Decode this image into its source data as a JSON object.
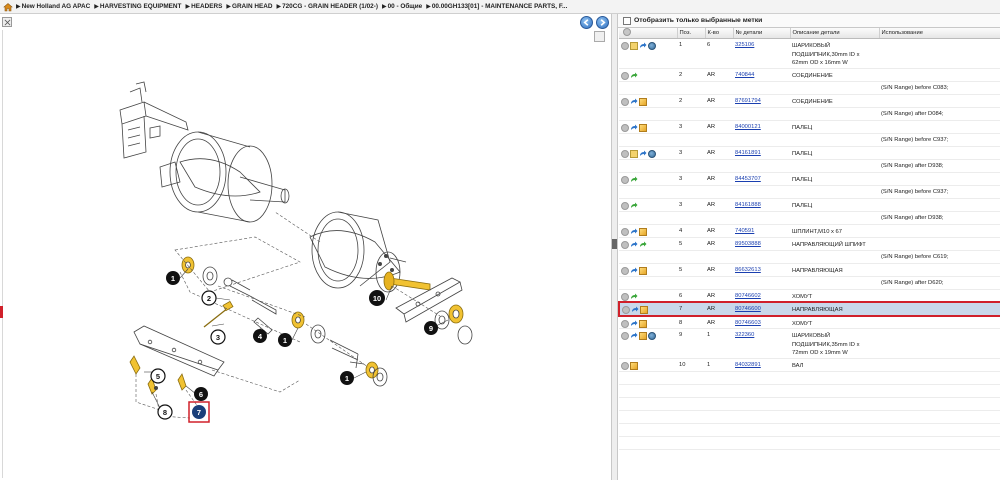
{
  "breadcrumb": {
    "home_icon": "home-icon",
    "items": [
      "New Holland AG APAC",
      "HARVESTING EQUIPMENT",
      "HEADERS",
      "GRAIN HEAD",
      "720CG - GRAIN HEADER (1/02-)",
      "00 - Общие",
      "00.00GH133[01] - MAINTENANCE PARTS, F..."
    ]
  },
  "toolbar": {
    "expand_icon": "expand-icon",
    "prev_icon": "prev-page-icon",
    "next_icon": "next-page-icon"
  },
  "diagram": {
    "callouts": [
      "1",
      "1",
      "1",
      "2",
      "3",
      "4",
      "5",
      "6",
      "7",
      "8",
      "9",
      "10"
    ],
    "highlighted_callout": "7"
  },
  "filter": {
    "label": "Отобразить только выбранные метки",
    "checked": false
  },
  "table": {
    "columns": [
      "",
      "Поз.",
      "К-во",
      "№ детали",
      "Описание детали",
      "Использование"
    ],
    "rows": [
      {
        "icons": [
          "circle",
          "note",
          "arrow-blue",
          "globe"
        ],
        "pos": "1",
        "qty": "6",
        "part": "325106",
        "desc": "ШАРИКОВЫЙ ПОДШИПНИК,30mm ID x 62mm OD x 16mm W",
        "usage": "",
        "selected": false
      },
      {
        "icons": [
          "circle",
          "arrow-green"
        ],
        "pos": "2",
        "qty": "AR",
        "part": "740844",
        "desc": "СОЕДИНЕНИЕ",
        "usage": "",
        "note": "(S/N Range) before C083;",
        "selected": false
      },
      {
        "icons": [
          "circle",
          "arrow-blue",
          "box"
        ],
        "pos": "2",
        "qty": "AR",
        "part": "87691794",
        "desc": "СОЕДИНЕНИЕ",
        "usage": "",
        "note": "(S/N Range) after D084;",
        "selected": false
      },
      {
        "icons": [
          "circle",
          "arrow-blue",
          "box"
        ],
        "pos": "3",
        "qty": "AR",
        "part": "84000121",
        "desc": "ПАЛЕЦ",
        "usage": "",
        "note": "(S/N Range) before C937;",
        "selected": false
      },
      {
        "icons": [
          "circle",
          "note",
          "arrow-blue",
          "globe"
        ],
        "pos": "3",
        "qty": "AR",
        "part": "84161891",
        "desc": "ПАЛЕЦ",
        "usage": "",
        "note": "(S/N Range) after D938;",
        "selected": false
      },
      {
        "icons": [
          "circle",
          "arrow-green"
        ],
        "pos": "3",
        "qty": "AR",
        "part": "84453707",
        "desc": "ПАЛЕЦ",
        "usage": "",
        "note": "(S/N Range) before C937;",
        "selected": false
      },
      {
        "icons": [
          "circle",
          "arrow-green"
        ],
        "pos": "3",
        "qty": "AR",
        "part": "84161888",
        "desc": "ПАЛЕЦ",
        "usage": "",
        "note": "(S/N Range) after D938;",
        "selected": false
      },
      {
        "icons": [
          "circle",
          "arrow-blue",
          "box"
        ],
        "pos": "4",
        "qty": "AR",
        "part": "740591",
        "desc": "ШПЛИНТ,M10 x 67",
        "usage": "",
        "selected": false
      },
      {
        "icons": [
          "circle",
          "arrow-blue",
          "arrow-green"
        ],
        "pos": "5",
        "qty": "AR",
        "part": "89503888",
        "desc": "НАПРАВЛЯЮЩИЙ ШПИФТ",
        "usage": "",
        "note": "(S/N Range) before C619;",
        "selected": false
      },
      {
        "icons": [
          "circle",
          "arrow-blue",
          "box"
        ],
        "pos": "5",
        "qty": "AR",
        "part": "86632613",
        "desc": "НАПРАВЛЯЮЩАЯ",
        "usage": "",
        "note": "(S/N Range) after D620;",
        "selected": false
      },
      {
        "icons": [
          "circle",
          "arrow-green"
        ],
        "pos": "6",
        "qty": "AR",
        "part": "80746602",
        "desc": "ХОМУТ",
        "usage": "",
        "selected": false
      },
      {
        "icons": [
          "circle",
          "arrow-blue",
          "box"
        ],
        "pos": "7",
        "qty": "AR",
        "part": "80746600",
        "desc": "НАПРАВЛЯЮЩАЯ",
        "usage": "",
        "selected": true
      },
      {
        "icons": [
          "circle",
          "arrow-blue",
          "box"
        ],
        "pos": "8",
        "qty": "AR",
        "part": "80746603",
        "desc": "ХОМУТ",
        "usage": "",
        "selected": false
      },
      {
        "icons": [
          "circle",
          "arrow-blue",
          "box",
          "globe"
        ],
        "pos": "9",
        "qty": "1",
        "part": "322360",
        "desc": "ШАРИКОВЫЙ ПОДШИПНИК,35mm ID x 72mm OD x 19mm W",
        "usage": "",
        "selected": false
      },
      {
        "icons": [
          "circle",
          "box"
        ],
        "pos": "10",
        "qty": "1",
        "part": "84032891",
        "desc": "ВАЛ",
        "usage": "",
        "selected": false
      }
    ]
  },
  "colors": {
    "selection_border": "#d0202a",
    "selection_fill": "#c9d8ea",
    "link": "#1a3fb0",
    "callout_fill": "#111111",
    "part_yellow": "#f1c232"
  }
}
